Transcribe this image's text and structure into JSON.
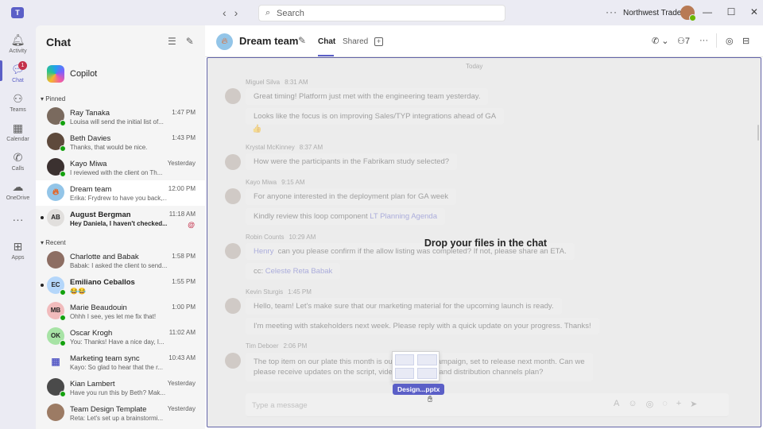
{
  "titlebar": {
    "app_logo": "T",
    "search_placeholder": "Search",
    "org_name": "Northwest Traders",
    "more_glyph": "···",
    "back_glyph": "‹",
    "forward_glyph": "›"
  },
  "rail": {
    "items": [
      {
        "label": "Activity",
        "icon": "bell-icon"
      },
      {
        "label": "Chat",
        "icon": "chat-icon",
        "badge": "1"
      },
      {
        "label": "Teams",
        "icon": "teams-icon"
      },
      {
        "label": "Calendar",
        "icon": "calendar-icon"
      },
      {
        "label": "Calls",
        "icon": "phone-icon"
      },
      {
        "label": "OneDrive",
        "icon": "cloud-icon"
      },
      {
        "label": "",
        "icon": "more-icon"
      },
      {
        "label": "Apps",
        "icon": "apps-icon"
      }
    ]
  },
  "chat_panel": {
    "title": "Chat",
    "copilot": "Copilot",
    "pinned_label": "Pinned",
    "recent_label": "Recent",
    "pinned": [
      {
        "name": "Ray Tanaka",
        "preview": "Louisa will send the initial list of...",
        "time": "1:47 PM"
      },
      {
        "name": "Beth Davies",
        "preview": "Thanks, that would be nice.",
        "time": "1:43 PM"
      },
      {
        "name": "Kayo Miwa",
        "preview": "I reviewed with the client on Th...",
        "time": "Yesterday"
      },
      {
        "name": "Dream team",
        "preview": "Erika: Frydrew to have you back,...",
        "time": "12:00 PM"
      },
      {
        "name": "August Bergman",
        "preview": "Hey Daniela, I haven't checked...",
        "time": "11:18 AM",
        "initials": "AB",
        "mention": "@"
      }
    ],
    "recent": [
      {
        "name": "Charlotte and Babak",
        "preview": "Babak: I asked the client to send...",
        "time": "1:58 PM"
      },
      {
        "name": "Emiliano Ceballos",
        "preview": "😂😂",
        "time": "1:55 PM",
        "initials": "EC"
      },
      {
        "name": "Marie Beaudouin",
        "preview": "Ohhh I see, yes let me fix that!",
        "time": "1:00 PM",
        "initials": "MB"
      },
      {
        "name": "Oscar Krogh",
        "preview": "You: Thanks! Have a nice day, I...",
        "time": "11:02 AM",
        "initials": "OK"
      },
      {
        "name": "Marketing team sync",
        "preview": "Kayo: So glad to hear that the r...",
        "time": "10:43 AM"
      },
      {
        "name": "Kian Lambert",
        "preview": "Have you run this by Beth? Mak...",
        "time": "Yesterday"
      },
      {
        "name": "Team Design Template",
        "preview": "Reta: Let's set up a brainstormi...",
        "time": "Yesterday"
      }
    ]
  },
  "header": {
    "title": "Dream team",
    "tabs": [
      "Chat",
      "Shared"
    ],
    "people_count": "7",
    "more_glyph": "···"
  },
  "messages": {
    "today": "Today",
    "m1_name": "Miguel Silva",
    "m1_time": "8:31 AM",
    "m1_text1": "Great timing! Platform just met with the engineering team yesterday.",
    "m1_text2": "Looks like the focus is on improving Sales/TYP integrations ahead of GA",
    "m1_emoji": "👍",
    "m2_name": "Krystal McKinney",
    "m2_time": "8:37 AM",
    "m2_text": "How were the participants in the Fabrikam study selected?",
    "m3_name": "Kayo Miwa",
    "m3_time": "9:15 AM",
    "m3_text1": "For anyone interested in the deployment plan for GA week",
    "m3_text2_prefix": "Kindly review this loop component",
    "m3_text2_link": "LT Planning Agenda",
    "m4_name": "Robin Counts",
    "m4_time": "10:29 AM",
    "m4_link": "Henry",
    "m4_text": "can you please confirm if the allow listing was completed? If not, please share an ETA.",
    "m4_cc_prefix": "cc:",
    "m4_cc_link": "Celeste Reta Babak",
    "m5_name": "Kevin Sturgis",
    "m5_time": "1:45 PM",
    "m5_text1": "Hello, team! Let's make sure that our marketing material for the upcoming launch is ready.",
    "m5_text2": "I'm meeting with stakeholders next week. Please reply with a quick update on your progress. Thanks!",
    "m6_name": "Tim Deboer",
    "m6_time": "2:06 PM",
    "m6_text1": "The top item on our plate this month is our new video campaign, set to release next month. Can we",
    "m6_text2": "please receive updates on the script, video voiceovers, and distribution channels plan?"
  },
  "drop": {
    "text": "Drop your files in the chat",
    "file_name": "Design...pptx"
  },
  "compose": {
    "placeholder": "Type a message"
  },
  "colors": {
    "brand": "#5b5fc7",
    "presence_available": "#13a10e",
    "mention": "#c4314b"
  }
}
